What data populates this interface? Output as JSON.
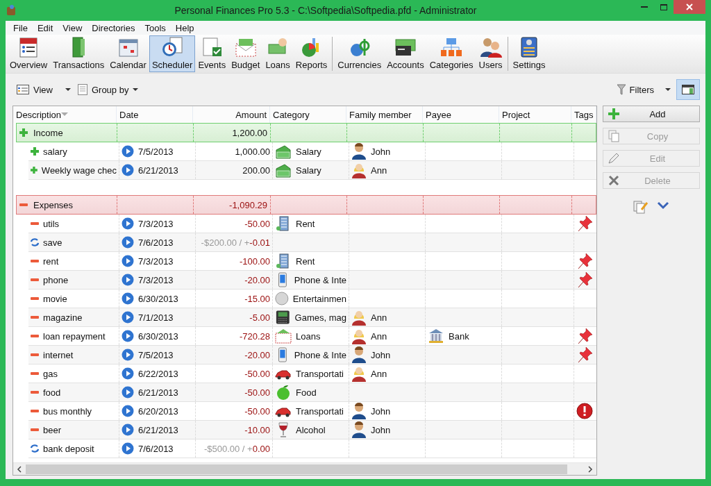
{
  "window": {
    "title": "Personal Finances Pro 5.3 - C:\\Softpedia\\Softpedia.pfd - Administrator"
  },
  "menu": [
    "File",
    "Edit",
    "View",
    "Directories",
    "Tools",
    "Help"
  ],
  "toolbar_groups": [
    {
      "items": [
        {
          "label": "Overview",
          "selected": false
        },
        {
          "label": "Transactions",
          "selected": false
        },
        {
          "label": "Calendar",
          "selected": false
        },
        {
          "label": "Scheduler",
          "selected": true
        },
        {
          "label": "Events",
          "selected": false
        },
        {
          "label": "Budget",
          "selected": false
        },
        {
          "label": "Loans",
          "selected": false
        },
        {
          "label": "Reports",
          "selected": false
        }
      ]
    },
    {
      "items": [
        {
          "label": "Currencies",
          "selected": false
        },
        {
          "label": "Accounts",
          "selected": false
        },
        {
          "label": "Categories",
          "selected": false
        },
        {
          "label": "Users",
          "selected": false
        }
      ]
    },
    {
      "items": [
        {
          "label": "Settings",
          "selected": false
        }
      ]
    }
  ],
  "subtoolbar": {
    "view": "View",
    "group_by": "Group by",
    "filters": "Filters",
    "panel_toggle_pressed": true
  },
  "table": {
    "columns": [
      "Description",
      "Date",
      "Amount",
      "Category",
      "Family member",
      "Payee",
      "Project",
      "Tags"
    ],
    "groups": [
      {
        "kind": "income",
        "label": "Income",
        "total": "1,200.00",
        "rows": [
          {
            "kind": "income",
            "description": "salary",
            "date": "7/5/2013",
            "amount": "1,000.00",
            "category": {
              "kind": "money",
              "name": "Salary"
            },
            "member": {
              "kind": "man",
              "name": "John"
            }
          },
          {
            "kind": "income",
            "description": "Weekly wage chec",
            "date": "6/21/2013",
            "amount": "200.00",
            "category": {
              "kind": "money",
              "name": "Salary"
            },
            "member": {
              "kind": "woman",
              "name": "Ann"
            }
          }
        ]
      },
      {
        "kind": "expense",
        "label": "Expenses",
        "total": "-1,090.29",
        "rows": [
          {
            "kind": "expense",
            "description": "utils",
            "date": "7/3/2013",
            "amount": "-50.00",
            "category": {
              "kind": "building",
              "name": "Rent"
            },
            "tag": {
              "kind": "pin"
            }
          },
          {
            "kind": "transfer",
            "description": "save",
            "date": "7/6/2013",
            "amount_planned": "-$200.00 / +",
            "amount": "-0.01"
          },
          {
            "kind": "expense",
            "description": "rent",
            "date": "7/3/2013",
            "amount": "-100.00",
            "category": {
              "kind": "building",
              "name": "Rent"
            },
            "tag": {
              "kind": "pin"
            }
          },
          {
            "kind": "expense",
            "description": "phone",
            "date": "7/3/2013",
            "amount": "-20.00",
            "category": {
              "kind": "phone",
              "name": "Phone & Inte"
            },
            "tag": {
              "kind": "pin"
            }
          },
          {
            "kind": "expense",
            "description": "movie",
            "date": "6/30/2013",
            "amount": "-15.00",
            "category": {
              "kind": "disc",
              "name": "Entertainmen"
            }
          },
          {
            "kind": "expense",
            "description": "magazine",
            "date": "7/1/2013",
            "amount": "-5.00",
            "category": {
              "kind": "gadget",
              "name": "Games, mag"
            },
            "member": {
              "kind": "woman",
              "name": "Ann"
            }
          },
          {
            "kind": "expense",
            "description": "loan repayment",
            "date": "6/30/2013",
            "amount": "-720.28",
            "category": {
              "kind": "envelope",
              "name": "Loans"
            },
            "member": {
              "kind": "woman",
              "name": "Ann"
            },
            "payee": "Bank",
            "tag": {
              "kind": "pin"
            }
          },
          {
            "kind": "expense",
            "description": "internet",
            "date": "7/5/2013",
            "amount": "-20.00",
            "category": {
              "kind": "phone",
              "name": "Phone & Inte"
            },
            "member": {
              "kind": "man",
              "name": "John"
            },
            "tag": {
              "kind": "pin"
            }
          },
          {
            "kind": "expense",
            "description": "gas",
            "date": "6/22/2013",
            "amount": "-50.00",
            "category": {
              "kind": "car",
              "name": "Transportati"
            },
            "member": {
              "kind": "woman",
              "name": "Ann"
            }
          },
          {
            "kind": "expense",
            "description": "food",
            "date": "6/21/2013",
            "amount": "-50.00",
            "category": {
              "kind": "apple",
              "name": "Food"
            }
          },
          {
            "kind": "expense",
            "description": "bus monthly",
            "date": "6/20/2013",
            "amount": "-50.00",
            "category": {
              "kind": "car",
              "name": "Transportati"
            },
            "member": {
              "kind": "man",
              "name": "John"
            },
            "tag": {
              "kind": "alert"
            }
          },
          {
            "kind": "expense",
            "description": "beer",
            "date": "6/21/2013",
            "amount": "-10.00",
            "category": {
              "kind": "wine",
              "name": "Alcohol"
            },
            "member": {
              "kind": "man",
              "name": "John"
            }
          },
          {
            "kind": "transfer",
            "description": "bank deposit",
            "date": "7/6/2013",
            "amount_planned": "-$500.00 / +",
            "amount": "0.00"
          }
        ]
      }
    ]
  },
  "side_buttons": [
    {
      "kind": "add",
      "label": "Add",
      "disabled": false
    },
    {
      "kind": "copy",
      "label": "Copy",
      "disabled": true
    },
    {
      "kind": "edit",
      "label": "Edit",
      "disabled": true
    },
    {
      "kind": "delete",
      "label": "Delete",
      "disabled": true
    }
  ]
}
